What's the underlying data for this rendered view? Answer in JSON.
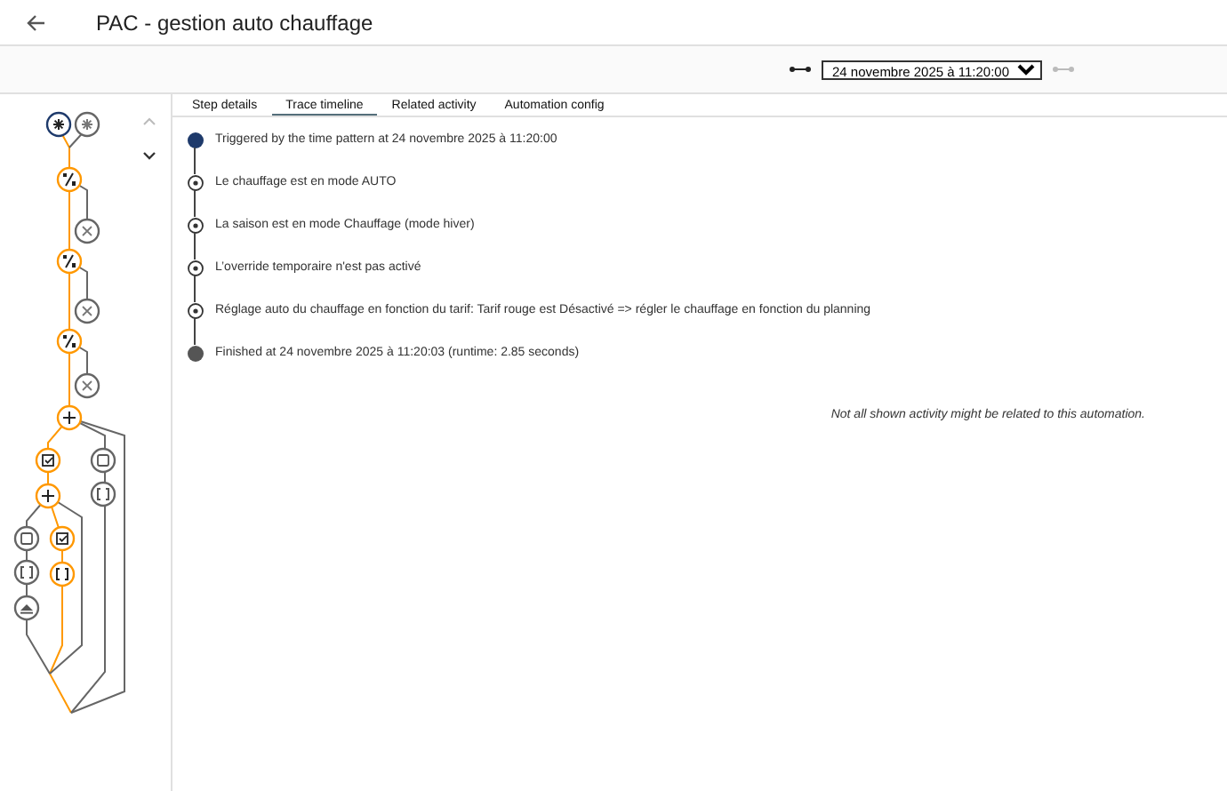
{
  "header": {
    "title": "PAC - gestion auto chauffage"
  },
  "toolbar": {
    "trace_select": {
      "value": "24 novembre 2025 à 11:20:00"
    }
  },
  "tabs": [
    {
      "label": "Step details",
      "selected": false
    },
    {
      "label": "Trace timeline",
      "selected": true
    },
    {
      "label": "Related activity",
      "selected": false
    },
    {
      "label": "Automation config",
      "selected": false
    }
  ],
  "timeline": [
    {
      "kind": "trigger",
      "text": "Triggered by the time pattern at 24 novembre 2025 à 11:20:00"
    },
    {
      "kind": "condition",
      "text": "Le chauffage est en mode AUTO"
    },
    {
      "kind": "condition",
      "text": "La saison est en mode Chauffage (mode hiver)"
    },
    {
      "kind": "condition",
      "text": "L’override temporaire n'est pas activé"
    },
    {
      "kind": "condition",
      "text": "Réglage auto du chauffage en fonction du tarif: Tarif rouge est Désactivé => régler le chauffage en fonction du planning"
    },
    {
      "kind": "finished",
      "text": "Finished at 24 novembre 2025 à 11:20:03 (runtime: 2.85 seconds)"
    }
  ],
  "note": "Not all shown activity might be related to this automation."
}
